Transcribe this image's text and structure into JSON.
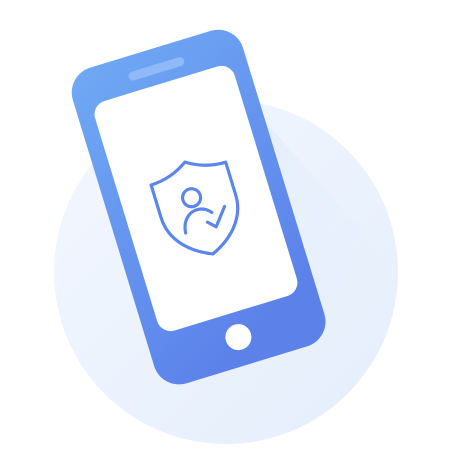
{
  "illustration": {
    "subject": "phone-with-security-shield",
    "icons": [
      "phone-icon",
      "shield-user-check-icon"
    ],
    "colors": {
      "background": "#ffffff",
      "circle_light": "#eef4fd",
      "circle_mid": "#e3edfb",
      "phone_top": "#6fa6f3",
      "phone_bottom": "#5f83ea",
      "screen": "#ffffff",
      "accent": "#5b86ee",
      "home_button": "#ffffff"
    }
  }
}
